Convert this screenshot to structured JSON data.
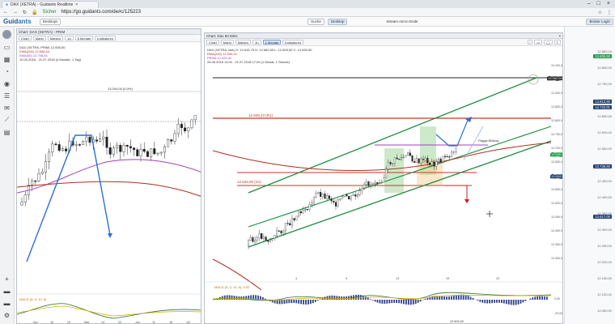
{
  "browser": {
    "tab_title": "DAX (XETRA) - Guidants Realtime",
    "secure_label": "Sicher",
    "url": "https://go.guidants.com/de#c/125223",
    "user_label": "Hessek"
  },
  "app": {
    "logo_text": "Guid",
    "logo_accent": "ants",
    "toolbar_button": "Desktops",
    "search_label": "Suche",
    "active_button": "Desktop",
    "news_label": "Stream Aircro Ende",
    "login_label": "Broker Login"
  },
  "left_chart": {
    "header": "Chart: DAX (XETRA) - PRIM",
    "tools": [
      "Chart",
      "Markt",
      "Marken",
      "1d",
      "6 Monate",
      "Indikatoren"
    ],
    "legend": [
      "DAX (XETRA, PRIM) 12.605,50",
      "EMA(200) 12.608,54",
      "EMA(50) 12.708,64",
      "10.04.2018 - 21.07.2018 (4 Monate, 1 Tag)"
    ],
    "peak_label": "13.204,00 (0,0%)",
    "x_ticks": [
      "Apr",
      "16",
      "23",
      "Mai",
      "14",
      "22",
      "Jun",
      "11",
      "18",
      "Jul"
    ],
    "indicator_label": "MACD (8, 3, 10, 5)"
  },
  "right_chart": {
    "header": "Chart: Dax 60 Mins",
    "tools": [
      "Chart",
      "Markt",
      "Marken",
      "1h",
      "1 Monate",
      "Indikatoren"
    ],
    "legend": [
      "DAX (XETRA, last) O: 12.615,75 H: 12.660,50 L: 12.609,50 C: 12.630,50",
      "EMA(200) 12.549,41",
      "PRMA 12.520,42",
      "26.06.2018 11:00 - 21.07.2018 17:00 (1 Monat, 1 Stunde)"
    ],
    "resistance_label": "12.949,23 (R1)",
    "support_label": "12.526,00 (S1)",
    "flag_label": "Flagge Bildung",
    "zone_label": "12.851,00 (3,1%)",
    "x_ticks": [
      "4",
      "9",
      "13",
      "19",
      "23"
    ],
    "y_ticks": [
      "13.100,00",
      "12.950,00",
      "12.900,00",
      "12.850,00",
      "12.800,00",
      "12.750,00",
      "12.700,00",
      "12.650,00",
      "12.600,00",
      "12.550,00",
      "12.500,00",
      "12.450,00",
      "12.400,00",
      "12.350,00",
      "12.300,00"
    ],
    "top_line_value": "13.062,60",
    "current_value": "12.630,50",
    "marker_value": "12.634,00",
    "indicator_label": "MACD (8, 3, 10, 5): 0,92",
    "indicator_ticks": [
      "0,00",
      "-20,00"
    ],
    "bottom_value": "12.604,00"
  },
  "right_column": {
    "prices": [
      {
        "value": "12.605,50",
        "color": "#1c9a4a"
      },
      {
        "value": "12.813,90",
        "color": "#1e3f73"
      },
      {
        "value": "12.722,91",
        "color": "#1e3f73"
      },
      {
        "value": "12.736,50",
        "color": "#1e3f73"
      },
      {
        "value": "12.617,00",
        "color": "#1e3f73"
      }
    ],
    "scale": [
      "12.850,00",
      "12.800,00",
      "12.750,00",
      "12.700,00",
      "12.650,00",
      "12.600,00",
      "12.550,00",
      "12.500,00",
      "12.450,00",
      "12.400,00",
      "12.350,00",
      "12.300,00",
      "12.250,00",
      "12.200,00",
      "12.150,00",
      "12.100,00",
      "12.050,00"
    ]
  },
  "colors": {
    "channel": "#1b8c3a",
    "resistance": "#c0392b",
    "ema_red": "#b03020",
    "ema_purple": "#a040c0",
    "arrow_blue": "#2a6fd6",
    "zone_green": "#8fd18a",
    "zone_orange": "#f6c98a"
  }
}
